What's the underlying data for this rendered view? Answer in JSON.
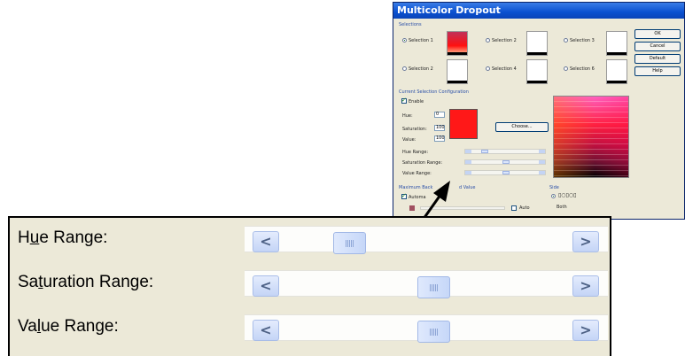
{
  "dialog": {
    "title": "Multicolor Dropout",
    "selections_group": "Selections",
    "selections": [
      {
        "label": "Selection 1",
        "checked": true
      },
      {
        "label": "Selection 2",
        "checked": false
      },
      {
        "label": "Selection 3",
        "checked": false
      },
      {
        "label": "Selection 2",
        "checked": false
      },
      {
        "label": "Selection 4",
        "checked": false
      },
      {
        "label": "Selection 6",
        "checked": false
      }
    ],
    "buttons": {
      "ok": "OK",
      "cancel": "Cancel",
      "default": "Default",
      "help": "Help"
    },
    "config_group": "Current Selection Configuration",
    "enable_label": "Enable",
    "hue_label": "Hue:",
    "hue_value": "0",
    "saturation_label": "Saturation:",
    "saturation_value": "100",
    "value_label": "Value:",
    "value_value": "100",
    "choose_button": "Choose...",
    "hue_range_label": "Hue Range:",
    "saturation_range_label": "Saturation Range:",
    "value_range_label": "Value Range:",
    "max_group": "Maximum Back",
    "max_group_tail": "d Value",
    "auto_check_label": "Automa",
    "auto_label": "Auto",
    "side_group": "Side",
    "side_value": "Both",
    "colors": {
      "selected_color": "#ff1818"
    }
  },
  "zoom": {
    "hue_range": {
      "label": "Hue Range:",
      "underline_char": "u",
      "thumb_pos": 0.12
    },
    "saturation_range": {
      "label": "Saturation Range:",
      "underline_char": "t",
      "thumb_pos": 0.5
    },
    "value_range": {
      "label": "Value Range:",
      "underline_char": "l",
      "thumb_pos": 0.5
    },
    "left_arrow_glyph": "<",
    "right_arrow_glyph": ">"
  }
}
